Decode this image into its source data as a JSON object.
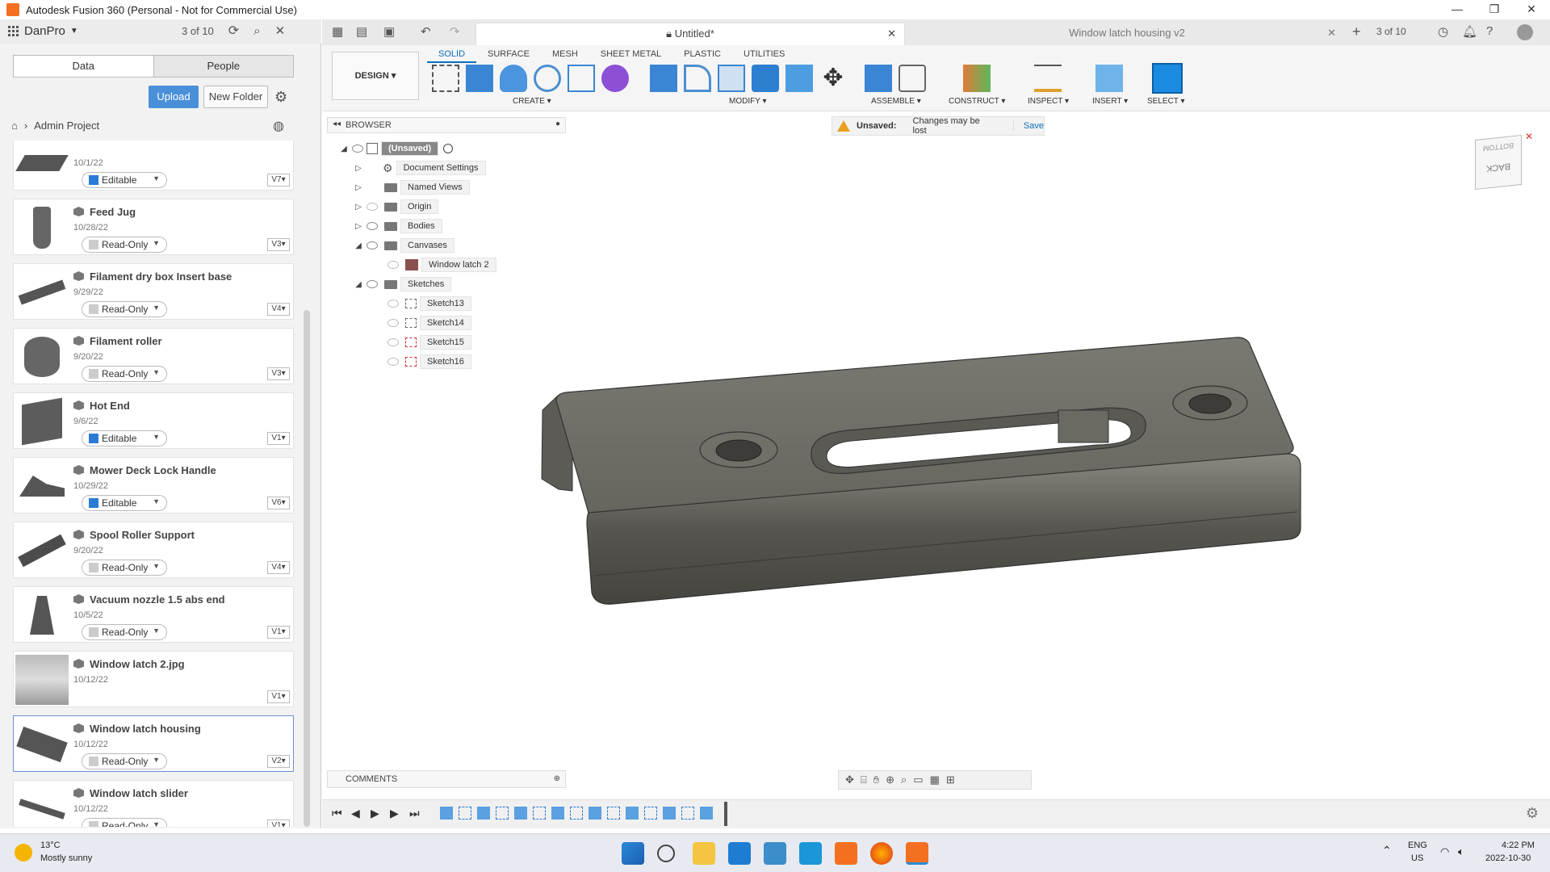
{
  "window": {
    "title": "Autodesk Fusion 360 (Personal - Not for Commercial Use)",
    "min": "—",
    "max": "❐",
    "close": "✕"
  },
  "data_panel": {
    "team_name": "DanPro",
    "file_counter": "3 of 10",
    "tabs": [
      "Data",
      "People"
    ],
    "upload_label": "Upload",
    "new_folder_label": "New Folder",
    "breadcrumb": [
      "Admin Project"
    ],
    "files": [
      {
        "name": "",
        "date": "10/1/22",
        "permission": "Editable",
        "version": "V7"
      },
      {
        "name": "Feed Jug",
        "date": "10/28/22",
        "permission": "Read-Only",
        "version": "V3"
      },
      {
        "name": "Filament dry box Insert base",
        "date": "9/29/22",
        "permission": "Read-Only",
        "version": "V4"
      },
      {
        "name": "Filament roller",
        "date": "9/20/22",
        "permission": "Read-Only",
        "version": "V3"
      },
      {
        "name": "Hot End",
        "date": "9/6/22",
        "permission": "Editable",
        "version": "V1"
      },
      {
        "name": "Mower Deck Lock Handle",
        "date": "10/29/22",
        "permission": "Editable",
        "version": "V6"
      },
      {
        "name": "Spool Roller Support",
        "date": "9/20/22",
        "permission": "Read-Only",
        "version": "V4"
      },
      {
        "name": "Vacuum nozzle 1.5 abs end",
        "date": "10/5/22",
        "permission": "Read-Only",
        "version": "V1"
      },
      {
        "name": "Window latch 2.jpg",
        "date": "10/12/22",
        "permission": "",
        "version": "V1"
      },
      {
        "name": "Window latch housing",
        "date": "10/12/22",
        "permission": "Read-Only",
        "version": "V2"
      },
      {
        "name": "Window latch slider",
        "date": "10/12/22",
        "permission": "Read-Only",
        "version": "V1"
      }
    ]
  },
  "doc_tabs": {
    "active": "Untitled*",
    "inactive": "Window latch housing v2",
    "counter": "3 of 10"
  },
  "toolbar": {
    "workspace": "DESIGN",
    "workspace_tabs": [
      "SOLID",
      "SURFACE",
      "MESH",
      "SHEET METAL",
      "PLASTIC",
      "UTILITIES"
    ],
    "groups": [
      "CREATE",
      "MODIFY",
      "ASSEMBLE",
      "CONSTRUCT",
      "INSPECT",
      "INSERT",
      "SELECT"
    ]
  },
  "browser": {
    "title": "BROWSER",
    "root": "(Unsaved)",
    "items": [
      "Document Settings",
      "Named Views",
      "Origin",
      "Bodies",
      "Canvases",
      "Window latch 2",
      "Sketches",
      "Sketch13",
      "Sketch14",
      "Sketch15",
      "Sketch16"
    ]
  },
  "unsaved_bar": {
    "label": "Unsaved:",
    "message": "Changes may be lost",
    "save": "Save"
  },
  "viewcube": {
    "face_top": "BOTTOM",
    "face_front": "BACK"
  },
  "comments_label": "COMMENTS",
  "taskbar": {
    "weather_temp": "13°C",
    "weather_text": "Mostly sunny",
    "lang": "ENG",
    "region": "US",
    "time": "4:22 PM",
    "date": "2022-10-30"
  },
  "colors": {
    "accent": "#0b6fbd",
    "upload": "#4a90d9",
    "model": "#6b6a63"
  }
}
